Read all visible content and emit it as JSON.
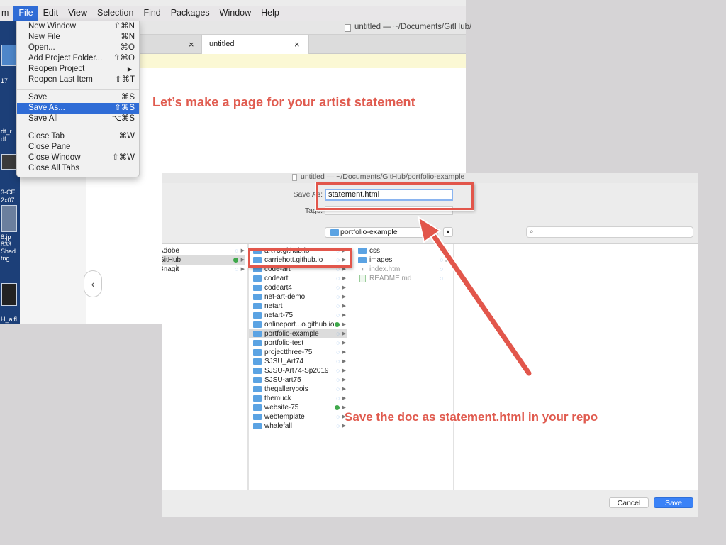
{
  "menubar": {
    "partial_app": "m",
    "items": [
      "File",
      "Edit",
      "View",
      "Selection",
      "Find",
      "Packages",
      "Window",
      "Help"
    ]
  },
  "desktop": {
    "labels": [
      "17",
      "dt_r",
      "df",
      "3-CE",
      "2x07",
      "8.jp",
      "833",
      "Shad",
      "tng.",
      "H_aifl"
    ]
  },
  "editor": {
    "window_title": "untitled — ~/Documents/GitHub/",
    "tabs": [
      {
        "label": ""
      },
      {
        "label": "untitled"
      }
    ],
    "close_glyph": "×",
    "collapse_glyph": "‹"
  },
  "file_menu": {
    "items": [
      {
        "label": "New Window",
        "shortcut": "⇧⌘N"
      },
      {
        "label": "New File",
        "shortcut": "⌘N"
      },
      {
        "label": "Open...",
        "shortcut": "⌘O"
      },
      {
        "label": "Add Project Folder...",
        "shortcut": "⇧⌘O"
      },
      {
        "label": "Reopen Project",
        "shortcut": "▶"
      },
      {
        "label": "Reopen Last Item",
        "shortcut": "⇧⌘T"
      },
      {
        "label": "Save",
        "shortcut": "⌘S"
      },
      {
        "label": "Save As...",
        "shortcut": "⇧⌘S",
        "highlighted": true
      },
      {
        "label": "Save All",
        "shortcut": "⌥⌘S"
      },
      {
        "label": "Close Tab",
        "shortcut": "⌘W"
      },
      {
        "label": "Close Pane",
        "shortcut": ""
      },
      {
        "label": "Close Window",
        "shortcut": "⇧⌘W"
      },
      {
        "label": "Close All Tabs",
        "shortcut": ""
      }
    ]
  },
  "annotations": {
    "top": "Let’s make a page for your artist statement",
    "bottom": "Save the doc as statement.html in your repo",
    "color": "#e2564b"
  },
  "save_dialog": {
    "window_title": "untitled — ~/Documents/GitHub/portfolio-example",
    "save_as_label": "Save As:",
    "save_as_value": "statement.html",
    "tags_label": "Tags:",
    "location": "portfolio-example",
    "search_icon": "search-icon",
    "sidebar": [
      {
        "name": "Adobe",
        "status": "sync"
      },
      {
        "name": "GitHub",
        "status": "ok",
        "selected": true
      },
      {
        "name": "Snagit",
        "status": "sync"
      }
    ],
    "repos": [
      {
        "name": "art75.github.io",
        "status": "sync"
      },
      {
        "name": "carriehott.github.io",
        "status": "sync"
      },
      {
        "name": "code-art",
        "status": "sync"
      },
      {
        "name": "codeart",
        "status": "sync"
      },
      {
        "name": "codeart4",
        "status": "sync"
      },
      {
        "name": "net-art-demo",
        "status": "sync"
      },
      {
        "name": "netart",
        "status": "sync"
      },
      {
        "name": "netart-75",
        "status": "sync"
      },
      {
        "name": "onlineport...o.github.io",
        "status": "ok"
      },
      {
        "name": "portfolio-example",
        "status": "sync",
        "selected": true
      },
      {
        "name": "portfolio-test",
        "status": "sync"
      },
      {
        "name": "projectthree-75",
        "status": "sync"
      },
      {
        "name": "SJSU_Art74",
        "status": "sync"
      },
      {
        "name": "SJSU-Art74-Sp2019",
        "status": "sync"
      },
      {
        "name": "SJSU-art75",
        "status": "sync"
      },
      {
        "name": "thegallerybois",
        "status": "sync"
      },
      {
        "name": "themuck",
        "status": "sync"
      },
      {
        "name": "website-75",
        "status": "ok"
      },
      {
        "name": "webtemplate",
        "status": "sync"
      },
      {
        "name": "whalefall",
        "status": "sync"
      }
    ],
    "contents": [
      {
        "name": "css",
        "type": "folder"
      },
      {
        "name": "images",
        "type": "folder"
      },
      {
        "name": "index.html",
        "type": "file"
      },
      {
        "name": "README.md",
        "type": "file"
      }
    ],
    "cancel_label": "Cancel",
    "save_label": "Save"
  }
}
